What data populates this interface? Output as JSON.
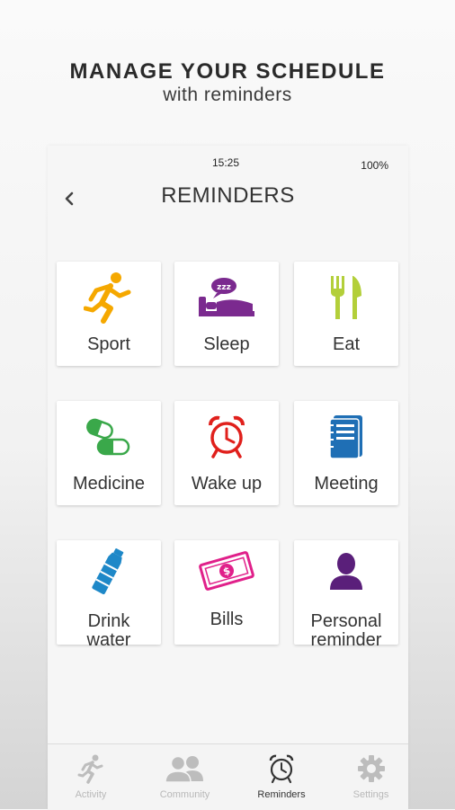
{
  "promo": {
    "headline": "MANAGE YOUR SCHEDULE",
    "subheadline": "with reminders"
  },
  "status_bar": {
    "time": "15:25",
    "battery": "100%"
  },
  "header": {
    "title": "REMINDERS"
  },
  "reminders": [
    {
      "label_line1": "Sport",
      "label_line2": "",
      "icon": "running-person-icon",
      "color": "#f5a800"
    },
    {
      "label_line1": "Sleep",
      "label_line2": "",
      "icon": "bed-icon",
      "color": "#7b2a8f"
    },
    {
      "label_line1": "Eat",
      "label_line2": "",
      "icon": "fork-knife-icon",
      "color": "#b3cf3a"
    },
    {
      "label_line1": "Medicine",
      "label_line2": "",
      "icon": "pills-icon",
      "color": "#3aa84a"
    },
    {
      "label_line1": "Wake up",
      "label_line2": "",
      "icon": "alarm-clock-icon",
      "color": "#e0201c"
    },
    {
      "label_line1": "Meeting",
      "label_line2": "",
      "icon": "notebook-icon",
      "color": "#1f6fb5"
    },
    {
      "label_line1": "Drink",
      "label_line2": "water",
      "icon": "water-bottle-icon",
      "color": "#1e88c8"
    },
    {
      "label_line1": "Bills",
      "label_line2": "",
      "icon": "money-bill-icon",
      "color": "#e0208a"
    },
    {
      "label_line1": "Personal",
      "label_line2": "reminder",
      "icon": "person-icon",
      "color": "#5a1f7a"
    }
  ],
  "tabs": [
    {
      "label": "Activity",
      "icon": "runner-icon",
      "active": false
    },
    {
      "label": "Community",
      "icon": "people-icon",
      "active": false
    },
    {
      "label": "Reminders",
      "icon": "alarm-clock-icon",
      "active": true
    },
    {
      "label": "Settings",
      "icon": "gear-icon",
      "active": false
    }
  ]
}
